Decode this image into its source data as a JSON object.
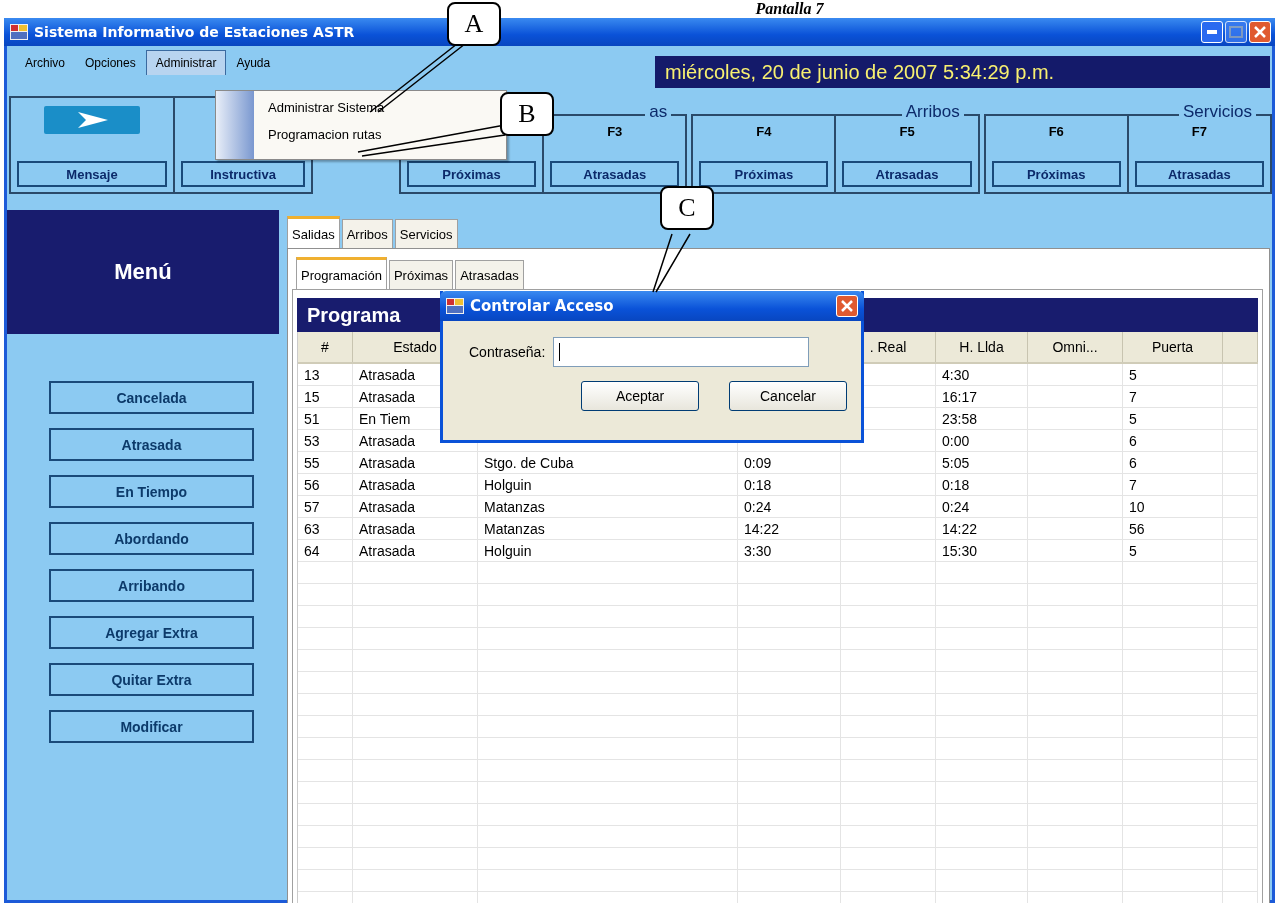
{
  "caption": "Pantalla 7",
  "window": {
    "title": "Sistema Informativo de Estaciones ASTR"
  },
  "menu": [
    {
      "label": "Archivo",
      "selected": false
    },
    {
      "label": "Opciones",
      "selected": false
    },
    {
      "label": "Administrar",
      "selected": true
    },
    {
      "label": "Ayuda",
      "selected": false
    }
  ],
  "dropdown": [
    "Administrar Sistema",
    "Programacion rutas"
  ],
  "datetime": "miércoles, 20 de junio de 2007 5:34:29 p.m.",
  "toolbar": {
    "left": [
      {
        "kind": "icon",
        "label": "Mensaje"
      },
      {
        "kind": "plain",
        "label": "Instructiva"
      }
    ],
    "groups": [
      {
        "title": "as",
        "buttons": [
          {
            "label": "Próximas"
          },
          {
            "key": "F3",
            "label": "Atrasadas"
          }
        ]
      },
      {
        "title": "Arribos",
        "buttons": [
          {
            "key": "F4",
            "label": "Próximas"
          },
          {
            "key": "F5",
            "label": "Atrasadas"
          }
        ]
      },
      {
        "title": "Servicios",
        "buttons": [
          {
            "key": "F6",
            "label": "Próximas"
          },
          {
            "key": "F7",
            "label": "Atrasadas"
          }
        ]
      }
    ]
  },
  "sidebar": {
    "title": "Menú",
    "buttons": [
      "Cancelada",
      "Atrasada",
      "En Tiempo",
      "Abordando",
      "Arribando",
      "Agregar Extra",
      "Quitar Extra",
      "Modificar"
    ]
  },
  "tabs": [
    {
      "label": "Salidas",
      "selected": true
    },
    {
      "label": "Arribos",
      "selected": false
    },
    {
      "label": "Servicios",
      "selected": false
    }
  ],
  "subtabs": [
    {
      "label": "Programación",
      "selected": true
    },
    {
      "label": "Próximas",
      "selected": false
    },
    {
      "label": "Atrasadas",
      "selected": false
    }
  ],
  "panel_title": "Programa",
  "table": {
    "columns": [
      "#",
      "Estado",
      null,
      null,
      ". Real",
      "H. Llda",
      "Omni...",
      "Puerta"
    ],
    "rows": [
      [
        "13",
        "Atrasada",
        null,
        null,
        null,
        "4:30",
        null,
        "5"
      ],
      [
        "15",
        "Atrasada",
        null,
        null,
        null,
        "16:17",
        null,
        "7"
      ],
      [
        "51",
        "En Tiem",
        null,
        null,
        null,
        "23:58",
        null,
        "5"
      ],
      [
        "53",
        "Atrasada",
        null,
        null,
        null,
        "0:00",
        null,
        "6"
      ],
      [
        "55",
        "Atrasada",
        "Stgo. de Cuba",
        "0:09",
        null,
        "5:05",
        null,
        "6"
      ],
      [
        "56",
        "Atrasada",
        "Holguin",
        "0:18",
        null,
        "0:18",
        null,
        "7"
      ],
      [
        "57",
        "Atrasada",
        "Matanzas",
        "0:24",
        null,
        "0:24",
        null,
        "10"
      ],
      [
        "63",
        "Atrasada",
        "Matanzas",
        "14:22",
        null,
        "14:22",
        null,
        "56"
      ],
      [
        "64",
        "Atrasada",
        "Holguin",
        "3:30",
        null,
        "15:30",
        null,
        "5"
      ]
    ]
  },
  "dialog": {
    "title": "Controlar Acceso",
    "label": "Contraseña:",
    "buttons": [
      "Aceptar",
      "Cancelar"
    ]
  },
  "callouts": [
    "A",
    "B",
    "C"
  ]
}
